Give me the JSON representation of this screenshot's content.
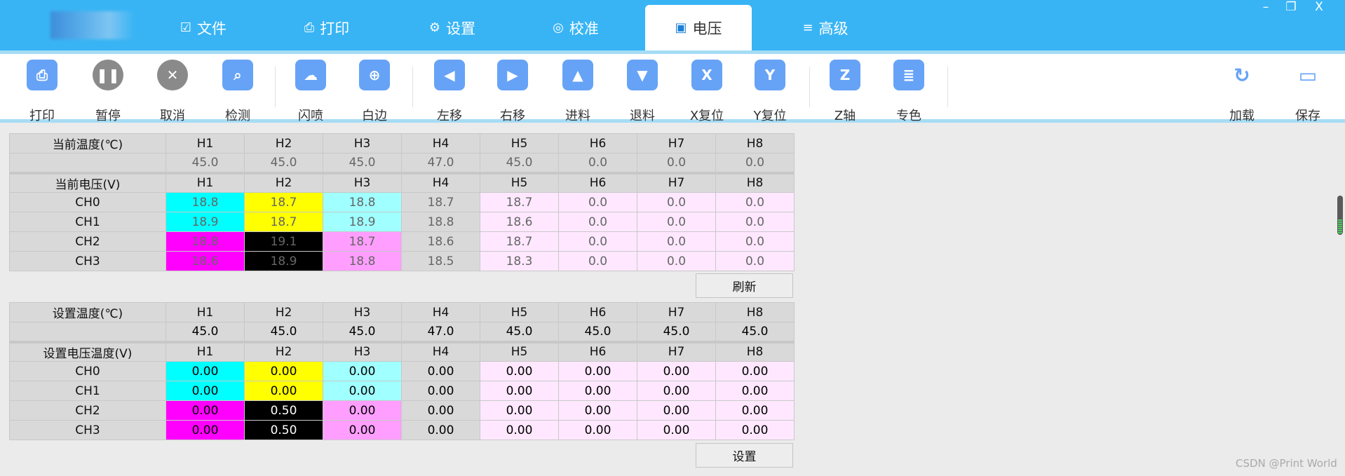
{
  "tabs": [
    {
      "label": "文件",
      "icon": "clipboard-check-icon",
      "glyph": "☑"
    },
    {
      "label": "打印",
      "icon": "printer-icon",
      "glyph": "⎙"
    },
    {
      "label": "设置",
      "icon": "gear-icon",
      "glyph": "⚙"
    },
    {
      "label": "校准",
      "icon": "crosshair-icon",
      "glyph": "◎"
    },
    {
      "label": "电压",
      "icon": "battery-icon",
      "glyph": "▣",
      "active": true
    },
    {
      "label": "高级",
      "icon": "layers-icon",
      "glyph": "≡"
    }
  ],
  "window": {
    "minimize": "–",
    "restore": "❐",
    "close": "X"
  },
  "toolbar": [
    {
      "label": "打印",
      "icon": "printer-icon",
      "glyph": "⎙",
      "style": "blue"
    },
    {
      "label": "暂停",
      "icon": "pause-icon",
      "glyph": "❚❚",
      "style": "grey"
    },
    {
      "label": "取消",
      "icon": "cancel-icon",
      "glyph": "✕",
      "style": "grey"
    },
    {
      "label": "检测",
      "icon": "inspect-icon",
      "glyph": "⌕",
      "style": "blue"
    },
    {
      "label": "闪喷",
      "icon": "spray-icon",
      "glyph": "☁",
      "style": "blue"
    },
    {
      "label": "白边",
      "icon": "target-icon",
      "glyph": "⊕",
      "style": "blue"
    },
    {
      "label": "左移",
      "icon": "move-left-icon",
      "glyph": "◀",
      "style": "blue"
    },
    {
      "label": "右移",
      "icon": "move-right-icon",
      "glyph": "▶",
      "style": "blue"
    },
    {
      "label": "进料",
      "icon": "feed-in-icon",
      "glyph": "▲",
      "style": "blue"
    },
    {
      "label": "退料",
      "icon": "feed-out-icon",
      "glyph": "▼",
      "style": "blue"
    },
    {
      "label": "X复位",
      "icon": "home-x-icon",
      "glyph": "X",
      "style": "blue"
    },
    {
      "label": "Y复位",
      "icon": "home-y-icon",
      "glyph": "Y",
      "style": "blue"
    },
    {
      "label": "Z轴",
      "icon": "z-axis-icon",
      "glyph": "Z",
      "style": "blue"
    },
    {
      "label": "专色",
      "icon": "document-icon",
      "glyph": "≣",
      "style": "blue"
    },
    {
      "label": "加载",
      "icon": "reload-icon",
      "glyph": "↻",
      "style": "plain"
    },
    {
      "label": "保存",
      "icon": "save-icon",
      "glyph": "▭",
      "style": "plain"
    }
  ],
  "colors": {
    "header": "#38b4f4",
    "col_bg": [
      "#00ffff",
      "#ffff00",
      "#a0ffff",
      "#d9d9d9",
      "#ffe8ff",
      "#ffe8ff",
      "#ffe8ff",
      "#ffe8ff"
    ],
    "col_bg_low": [
      "#ff00ff",
      "#000000",
      "#ff9eff",
      "#d9d9d9",
      "#ffe8ff",
      "#ffe8ff",
      "#ffe8ff",
      "#ffe8ff"
    ]
  },
  "heads": [
    "H1",
    "H2",
    "H3",
    "H4",
    "H5",
    "H6",
    "H7",
    "H8"
  ],
  "current": {
    "temp_label": "当前温度(℃)",
    "temps": [
      "45.0",
      "45.0",
      "45.0",
      "47.0",
      "45.0",
      "0.0",
      "0.0",
      "0.0"
    ],
    "volt_label": "当前电压(V)",
    "rows": [
      {
        "ch": "CH0",
        "vals": [
          "18.8",
          "18.7",
          "18.8",
          "18.7",
          "18.7",
          "0.0",
          "0.0",
          "0.0"
        ]
      },
      {
        "ch": "CH1",
        "vals": [
          "18.9",
          "18.7",
          "18.9",
          "18.8",
          "18.6",
          "0.0",
          "0.0",
          "0.0"
        ]
      },
      {
        "ch": "CH2",
        "vals": [
          "18.8",
          "19.1",
          "18.7",
          "18.6",
          "18.7",
          "0.0",
          "0.0",
          "0.0"
        ]
      },
      {
        "ch": "CH3",
        "vals": [
          "18.6",
          "18.9",
          "18.8",
          "18.5",
          "18.3",
          "0.0",
          "0.0",
          "0.0"
        ]
      }
    ],
    "button": "刷新"
  },
  "setting": {
    "temp_label": "设置温度(℃)",
    "temps": [
      "45.0",
      "45.0",
      "45.0",
      "47.0",
      "45.0",
      "45.0",
      "45.0",
      "45.0"
    ],
    "volt_label": "设置电压温度(V)",
    "rows": [
      {
        "ch": "CH0",
        "vals": [
          "0.00",
          "0.00",
          "0.00",
          "0.00",
          "0.00",
          "0.00",
          "0.00",
          "0.00"
        ]
      },
      {
        "ch": "CH1",
        "vals": [
          "0.00",
          "0.00",
          "0.00",
          "0.00",
          "0.00",
          "0.00",
          "0.00",
          "0.00"
        ]
      },
      {
        "ch": "CH2",
        "vals": [
          "0.00",
          "0.50",
          "0.00",
          "0.00",
          "0.00",
          "0.00",
          "0.00",
          "0.00"
        ]
      },
      {
        "ch": "CH3",
        "vals": [
          "0.00",
          "0.50",
          "0.00",
          "0.00",
          "0.00",
          "0.00",
          "0.00",
          "0.00"
        ]
      }
    ],
    "button": "设置"
  },
  "level_indicator": {
    "fill_fraction": 0.35
  },
  "watermark": "CSDN @Print World"
}
